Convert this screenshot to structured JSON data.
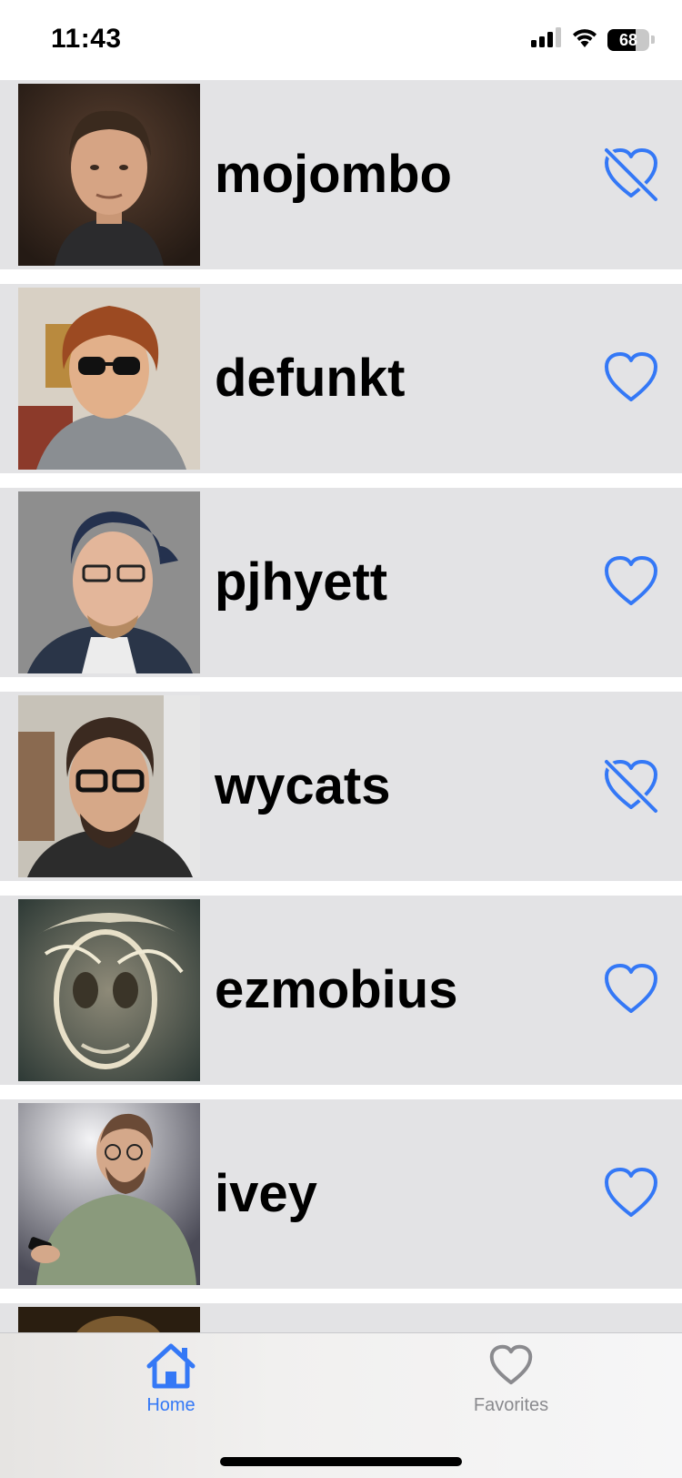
{
  "status_bar": {
    "time": "11:43",
    "battery": "68",
    "signal_icon": "cellular-signal-icon",
    "wifi_icon": "wifi-icon",
    "battery_icon": "battery-icon"
  },
  "users": [
    {
      "name": "mojombo",
      "favorite_icon": "heart-slash-icon"
    },
    {
      "name": "defunkt",
      "favorite_icon": "heart-icon"
    },
    {
      "name": "pjhyett",
      "favorite_icon": "heart-icon"
    },
    {
      "name": "wycats",
      "favorite_icon": "heart-slash-icon"
    },
    {
      "name": "ezmobius",
      "favorite_icon": "heart-icon"
    },
    {
      "name": "ivey",
      "favorite_icon": "heart-icon"
    }
  ],
  "tab_bar": {
    "tabs": [
      {
        "label": "Home",
        "icon": "house-icon",
        "selected": true
      },
      {
        "label": "Favorites",
        "icon": "heart-icon",
        "selected": false
      }
    ]
  },
  "colors": {
    "accent": "#3478f6",
    "row_background": "#e3e3e5",
    "inactive_tab": "#8a8a8e"
  }
}
